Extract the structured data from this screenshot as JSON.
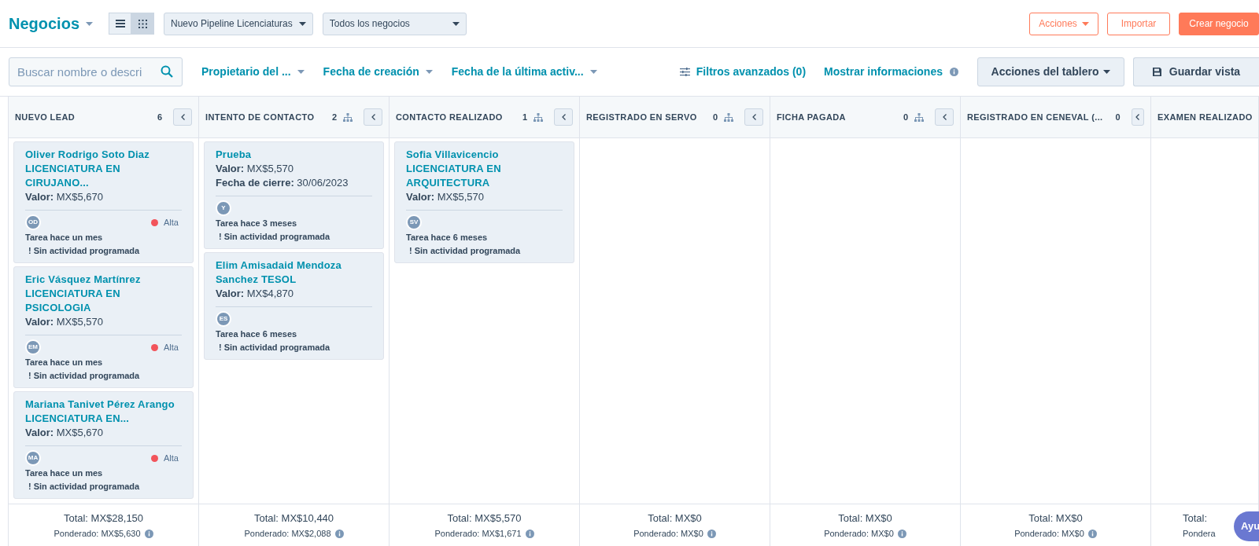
{
  "header": {
    "title": "Negocios",
    "views": [
      {
        "kind": "list",
        "selected": false
      },
      {
        "kind": "grid",
        "selected": true
      }
    ],
    "dropdowns": [
      "Nuevo Pipeline Licenciaturas",
      "Todos los negocios"
    ],
    "buttons": [
      {
        "label": "Acciones",
        "kind": "menu"
      },
      {
        "label": "Importar",
        "kind": "outline"
      },
      {
        "label": "Crear negocio",
        "kind": "primary"
      }
    ]
  },
  "filters": {
    "search": {
      "placeholder": "Buscar nombre o descri"
    },
    "dropdowns": [
      "Propietario del ...",
      "Fecha de creación",
      "Fecha de la última activ..."
    ],
    "advanced": "Filtros avanzados (0)",
    "info": "Mostrar informaciones",
    "board_actions": "Acciones del tablero",
    "save_view": "Guardar vista"
  },
  "columns": [
    {
      "title": "NUEVO LEAD",
      "count": "6",
      "automation": false,
      "collapse": true,
      "total": "Total: MX$28,150",
      "weighted": "Ponderado: MX$5,630",
      "deals": [
        {
          "name": "Oliver Rodrigo Soto Diaz LICENCIATURA EN CIRUJANO...",
          "fields": [
            {
              "label": "Valor:",
              "value": "MX$5,670"
            }
          ],
          "avatar": "OD",
          "priority": {
            "label": "Alta",
            "color": "#f2545b"
          },
          "task": "Tarea hace un mes",
          "activity": "! Sin actividad programada"
        },
        {
          "name": "Eric Vásquez Martínrez LICENCIATURA EN PSICOLOGIA",
          "fields": [
            {
              "label": "Valor:",
              "value": "MX$5,570"
            }
          ],
          "avatar": "EM",
          "priority": {
            "label": "Alta",
            "color": "#f2545b"
          },
          "task": "Tarea hace un mes",
          "activity": "! Sin actividad programada"
        },
        {
          "name": "Mariana Tanivet Pérez Arango LICENCIATURA EN...",
          "fields": [
            {
              "label": "Valor:",
              "value": "MX$5,670"
            }
          ],
          "avatar": "MA",
          "priority": {
            "label": "Alta",
            "color": "#f2545b"
          },
          "task": "Tarea hace un mes",
          "activity": "! Sin actividad programada"
        }
      ]
    },
    {
      "title": "INTENTO DE CONTACTO",
      "count": "2",
      "automation": true,
      "collapse": true,
      "total": "Total: MX$10,440",
      "weighted": "Ponderado: MX$2,088",
      "deals": [
        {
          "name": "Prueba",
          "fields": [
            {
              "label": "Valor:",
              "value": "MX$5,570"
            },
            {
              "label": "Fecha de cierre:",
              "value": "30/06/2023"
            }
          ],
          "avatar": "Y",
          "task": "Tarea hace 3 meses",
          "activity": "! Sin actividad programada"
        },
        {
          "name": "Elim Amisadaid Mendoza Sanchez TESOL",
          "fields": [
            {
              "label": "Valor:",
              "value": "MX$4,870"
            }
          ],
          "avatar": "ES",
          "task": "Tarea hace 6 meses",
          "activity": "! Sin actividad programada"
        }
      ]
    },
    {
      "title": "CONTACTO REALIZADO",
      "count": "1",
      "automation": true,
      "collapse": true,
      "total": "Total: MX$5,570",
      "weighted": "Ponderado: MX$1,671",
      "deals": [
        {
          "name": "Sofia Villavicencio LICENCIATURA EN ARQUITECTURA",
          "fields": [
            {
              "label": "Valor:",
              "value": "MX$5,570"
            }
          ],
          "avatar": "SV",
          "task": "Tarea hace 6 meses",
          "activity": "! Sin actividad programada"
        }
      ]
    },
    {
      "title": "REGISTRADO EN SERVO",
      "count": "0",
      "automation": true,
      "collapse": true,
      "total": "Total: MX$0",
      "weighted": "Ponderado: MX$0"
    },
    {
      "title": "FICHA PAGADA",
      "count": "0",
      "automation": true,
      "collapse": true,
      "total": "Total: MX$0",
      "weighted": "Ponderado: MX$0"
    },
    {
      "title": "REGISTRADO EN CENEVAL (...",
      "count": "0",
      "automation": false,
      "collapse": true,
      "total": "Total: MX$0",
      "weighted": "Ponderado: MX$0"
    },
    {
      "title": "EXAMEN REALIZADO",
      "automation": false,
      "collapse": false,
      "total": "Total:",
      "weighted": "Pondera"
    }
  ],
  "help": "Ayu"
}
